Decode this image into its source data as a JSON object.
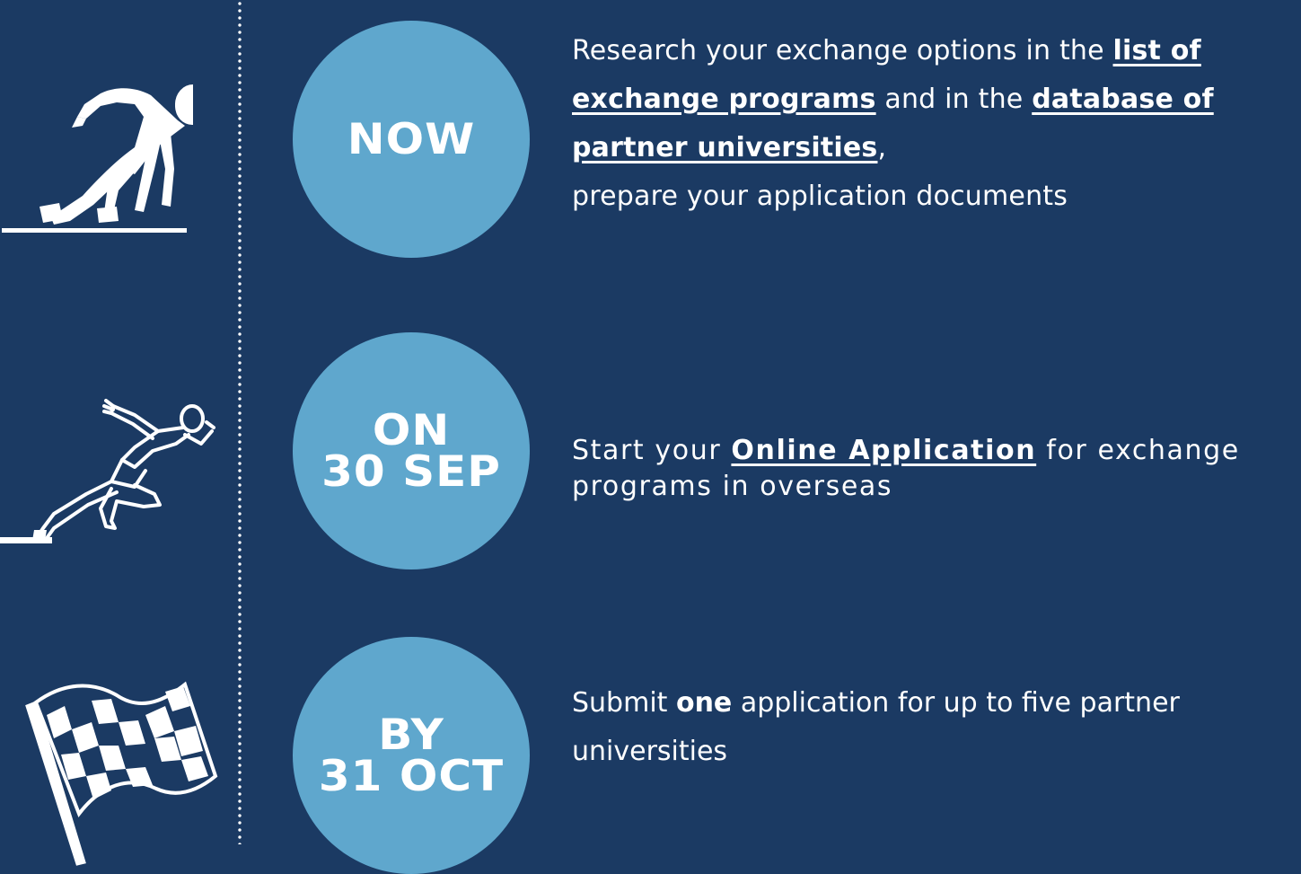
{
  "steps": [
    {
      "icon": "crouch-start-runner-icon",
      "circle": {
        "line1": "NOW",
        "line2": ""
      },
      "text": {
        "intro": "Research your exchange options in the ",
        "link1": "list of exchange programs",
        "middle": " and in the ",
        "link2": "database of partner universities",
        "comma": ",",
        "tail": "prepare your application documents"
      }
    },
    {
      "icon": "sprinting-runner-icon",
      "circle": {
        "line1": "ON",
        "line2": "30 SEP"
      },
      "text": {
        "before": "Start your ",
        "link": "Online Application",
        "after": " for exchange programs in overseas"
      }
    },
    {
      "icon": "checkered-flag-icon",
      "circle": {
        "line1": "BY",
        "line2": "31 OCT"
      },
      "text": {
        "before": "Submit ",
        "bold": "one",
        "after": " application for up to five partner universities"
      }
    }
  ],
  "colors": {
    "background": "#1b3a63",
    "circle": "#5fa7cd",
    "text": "#ffffff"
  }
}
